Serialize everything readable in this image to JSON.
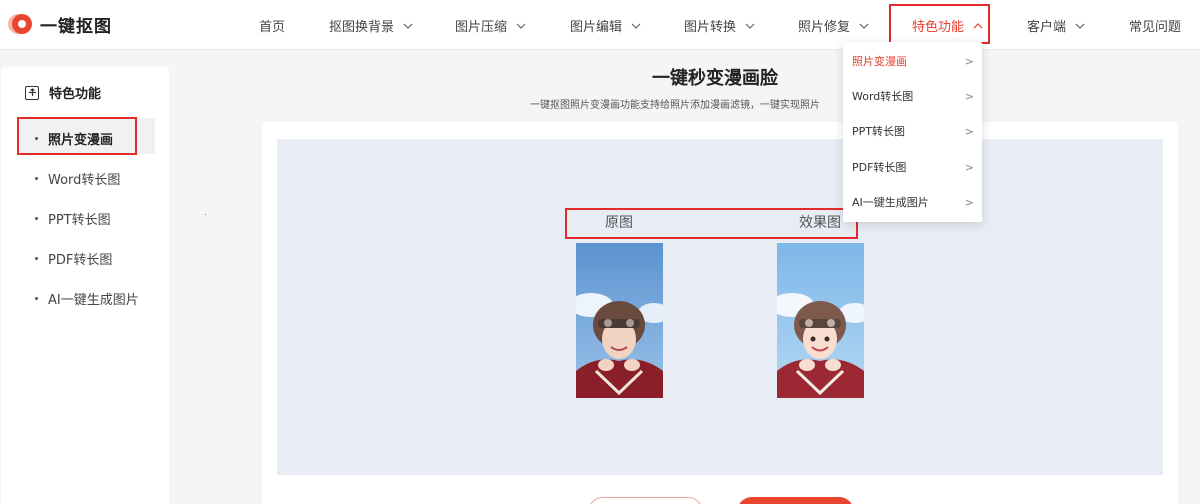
{
  "brand": {
    "name": "一键抠图"
  },
  "nav": {
    "items": [
      {
        "label": "首页",
        "has_dropdown": false
      },
      {
        "label": "抠图换背景",
        "has_dropdown": true
      },
      {
        "label": "图片压缩",
        "has_dropdown": true
      },
      {
        "label": "图片编辑",
        "has_dropdown": true
      },
      {
        "label": "图片转换",
        "has_dropdown": true
      },
      {
        "label": "照片修复",
        "has_dropdown": true
      },
      {
        "label": "特色功能",
        "has_dropdown": true,
        "active": true
      },
      {
        "label": "客户端",
        "has_dropdown": true
      },
      {
        "label": "常见问题",
        "has_dropdown": false
      }
    ]
  },
  "dropdown": {
    "items": [
      {
        "label": "照片变漫画",
        "active": true
      },
      {
        "label": "Word转长图"
      },
      {
        "label": "PPT转长图"
      },
      {
        "label": "PDF转长图"
      },
      {
        "label": "AI一键生成图片"
      }
    ],
    "arrow_glyph": ">"
  },
  "sidebar": {
    "heading": "特色功能",
    "items": [
      {
        "label": "照片变漫画",
        "active": true
      },
      {
        "label": "Word转长图"
      },
      {
        "label": "PPT转长图"
      },
      {
        "label": "PDF转长图"
      },
      {
        "label": "AI一键生成图片"
      }
    ]
  },
  "main": {
    "title": "一键秒变漫画脸",
    "subtitle": "一键抠图照片变漫画功能支持给照片添加漫画滤镜，一键实现照片",
    "label_original": "原图",
    "label_effect": "效果图"
  },
  "colors": {
    "accent": "#e8442f",
    "highlight_box": "#e32b2b",
    "active_text": "#e83d2b"
  }
}
